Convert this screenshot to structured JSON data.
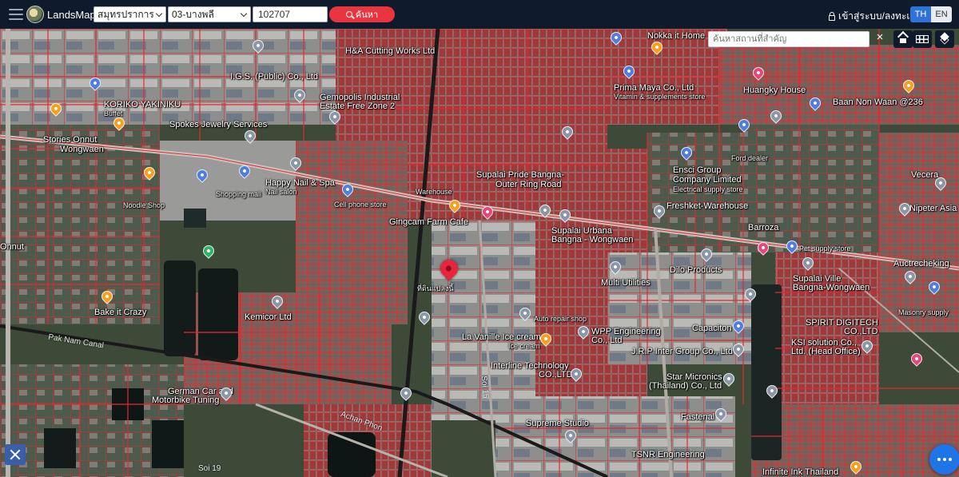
{
  "app": {
    "brand": "LandsMaps"
  },
  "topbar": {
    "province": "สมุทรปราการ",
    "district": "03-บางพลี",
    "parcel_code": "102707",
    "search_label": "ค้นหา",
    "login_label": "เข้าสู่ระบบ/ลงทะเบียน",
    "lang_th": "TH",
    "lang_en": "EN",
    "active_lang": "TH"
  },
  "map_tools": {
    "place_search_placeholder": "ค้นหาสถานที่สำคัญ",
    "clear": "×"
  },
  "map": {
    "parcel_line_color": "#e8262e",
    "main_road_color": "#1a1a1a",
    "selected_pin_color": "#e8253a",
    "selected_parcel_label": "ที่ดินแปลงนี้",
    "labels": [
      "Nokka it Home",
      "H&A Cutting Works Ltd",
      "I.G.S. (Public) Co., Ltd",
      "Gemopolis Industrial",
      "Estate Free Zone 2",
      "KORIKO YAKINIKU",
      "Buffet",
      "Spokes Jewelry Services",
      "Stories Onnut",
      "Wongwaen",
      "Noodle Shop",
      "Shopping mall",
      "Happy Nail & Spa",
      "Nail salon",
      "Cell phone store",
      "Warehouse",
      "Gingcam Farm Cafe",
      "Supalai Pride Bangna-",
      "Outer Ring Road",
      "Supalai Urbana",
      "Bangna - Wongwaen",
      "Prima Maya Co., Ltd",
      "Vitamin & supplements store",
      "Huangky House",
      "Baan Non Waan @236",
      "Ford dealer",
      "Ensci Group",
      "Company Limited",
      "Electrical supply store",
      "Freshket-Warehouse",
      "Vecera",
      "Nipeter Asia",
      "Barroza",
      "Pet supply store",
      "Auctrecheking",
      "Supalai Ville",
      "Bangna-Wongwaen",
      "Multi Utilities",
      "Dilo Products",
      "Bake it Crazy",
      "Kemicor Ltd",
      "Auto repair shop",
      "WPP Engineering",
      "Co., Ltd",
      "Capaciton",
      "SPIRIT DIGITECH",
      "CO.,LTD",
      "KSI solution Co.,",
      "Ltd. (Head Office)",
      "Masonry supply",
      "La Vanille Ice cream",
      "Ice cream",
      "J.R.P Inter Group Co., Ltd",
      "Interline Technology",
      "CO.,LTD",
      "Star Micronics",
      "(Thailand) Co., Ltd",
      "German Car and",
      "Motorbike Tuning",
      "Fastenal",
      "Supreme Studio",
      "TSNR Engineering",
      "Infinite Ink Thailand",
      "Pak Nam Canal",
      "Achan Phon",
      "Soi 19",
      "Soi 15",
      "Onnut"
    ]
  }
}
